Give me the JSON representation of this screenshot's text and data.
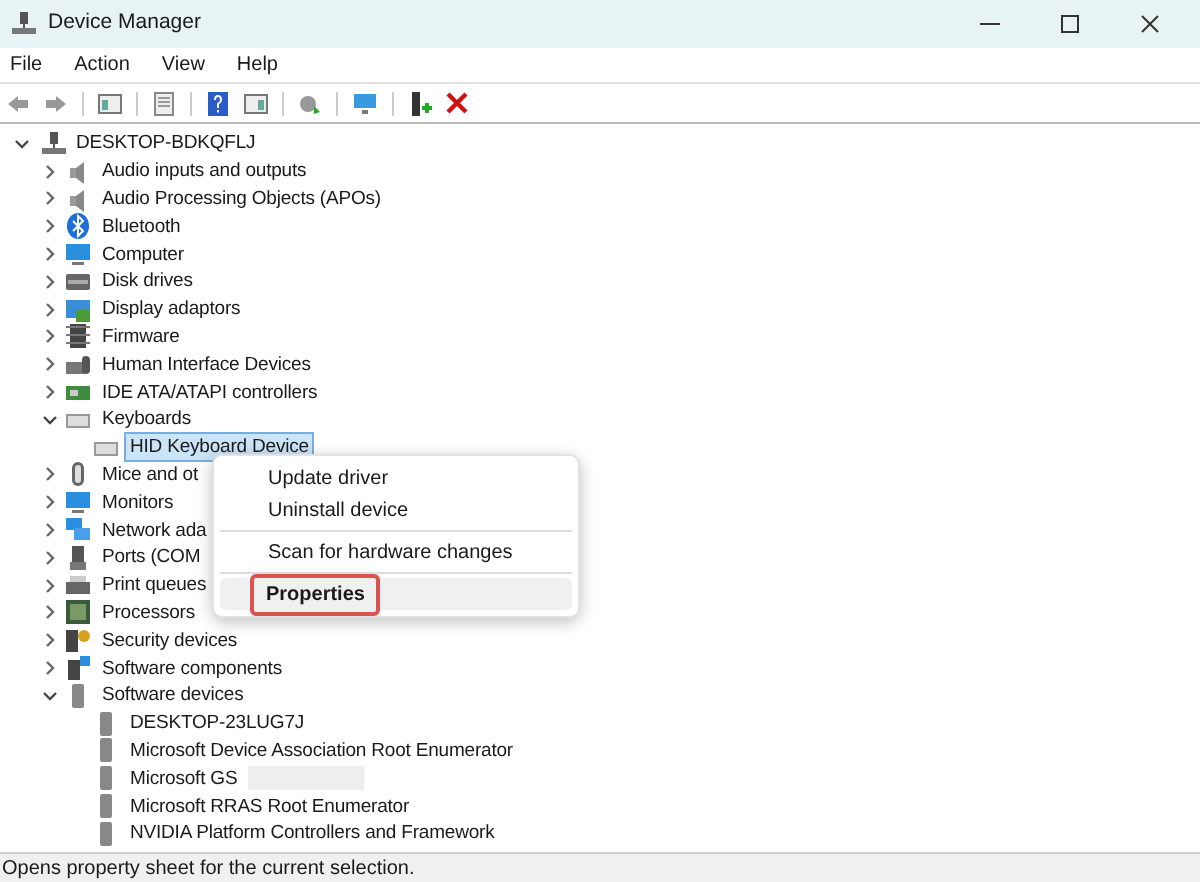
{
  "window": {
    "title": "Device Manager"
  },
  "menu_bar": [
    "File",
    "Action",
    "View",
    "Help"
  ],
  "tree": {
    "label": "DESKTOP-BDKQFLJ",
    "expanded": true,
    "selected": false,
    "children": [
      {
        "label": "Audio inputs and outputs",
        "expanded": false,
        "selected": false
      },
      {
        "label": "Audio Processing Objects (APOs)",
        "expanded": false,
        "selected": false
      },
      {
        "label": "Bluetooth",
        "expanded": false,
        "selected": false
      },
      {
        "label": "Computer",
        "expanded": false,
        "selected": false
      },
      {
        "label": "Disk drives",
        "expanded": false,
        "selected": false
      },
      {
        "label": "Display adaptors",
        "expanded": false,
        "selected": false
      },
      {
        "label": "Firmware",
        "expanded": false,
        "selected": false
      },
      {
        "label": "Human Interface Devices",
        "expanded": false,
        "selected": false
      },
      {
        "label": "IDE ATA/ATAPI controllers",
        "expanded": false,
        "selected": false
      },
      {
        "label": "Keyboards",
        "expanded": true,
        "selected": false,
        "children": [
          {
            "label": "HID Keyboard Device",
            "selected": true
          }
        ]
      },
      {
        "label": "Mice and ot",
        "expanded": false,
        "selected": false
      },
      {
        "label": "Monitors",
        "expanded": false,
        "selected": false
      },
      {
        "label": "Network ada",
        "expanded": false,
        "selected": false
      },
      {
        "label": "Ports (COM",
        "expanded": false,
        "selected": false
      },
      {
        "label": "Print queues",
        "expanded": false,
        "selected": false
      },
      {
        "label": "Processors",
        "expanded": false,
        "selected": false
      },
      {
        "label": "Security devices",
        "expanded": false,
        "selected": false
      },
      {
        "label": "Software components",
        "expanded": false,
        "selected": false
      },
      {
        "label": "Software devices",
        "expanded": true,
        "selected": false,
        "children": [
          {
            "label": "DESKTOP-23LUG7J",
            "selected": false
          },
          {
            "label": "Microsoft Device Association Root Enumerator",
            "selected": false
          },
          {
            "label": "Microsoft GS",
            "selected": false,
            "redacted": true
          },
          {
            "label": "Microsoft RRAS Root Enumerator",
            "selected": false
          },
          {
            "label": "NVIDIA Platform Controllers and Framework",
            "selected": false
          }
        ]
      }
    ]
  },
  "context_menu": {
    "groups": [
      [
        {
          "label": "Update driver",
          "selected": false
        },
        {
          "label": "Uninstall device",
          "selected": false
        }
      ],
      [
        {
          "label": "Scan for hardware changes",
          "selected": false
        }
      ],
      [
        {
          "label": "Properties",
          "selected": true
        }
      ]
    ]
  },
  "status_bar": "Opens property sheet for the current selection."
}
